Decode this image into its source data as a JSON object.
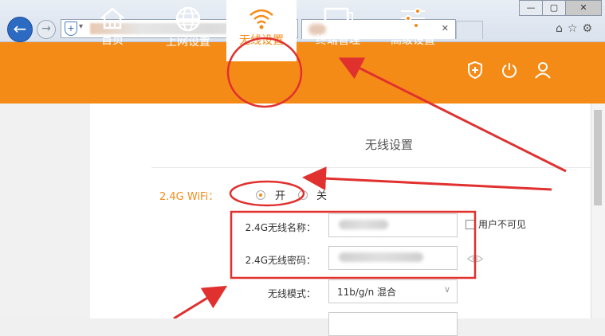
{
  "browser": {
    "window_buttons": [
      "—",
      "▢",
      "✕"
    ],
    "address_dropdown": "▾",
    "address_tools": "▾ ↻",
    "tab_close": "✕",
    "right_icons": "⌂☆⚙"
  },
  "nav": {
    "items": [
      {
        "label": "首页",
        "icon": "home-icon"
      },
      {
        "label": "上网设置",
        "icon": "globe-icon"
      },
      {
        "label": "无线设置",
        "icon": "wifi-icon"
      },
      {
        "label": "终端管理",
        "icon": "monitor-icon"
      },
      {
        "label": "高级设置",
        "icon": "sliders-icon"
      }
    ],
    "active": "无线设置",
    "right_icons": [
      "shield-icon",
      "power-icon",
      "user-icon"
    ]
  },
  "page": {
    "title": "无线设置",
    "wifi_label": "2.4G WiFi：",
    "on_label": "开",
    "off_label": "关",
    "wifi_enabled": true,
    "fields": {
      "ssid_label": "2.4G无线名称：",
      "password_label": "2.4G无线密码：",
      "mode_label": "无线模式：",
      "mode_value": "11b/g/n 混合",
      "hide_label": "用户不可见"
    }
  },
  "colors": {
    "brand": "#f58b17",
    "annotation": "#e0312f"
  }
}
